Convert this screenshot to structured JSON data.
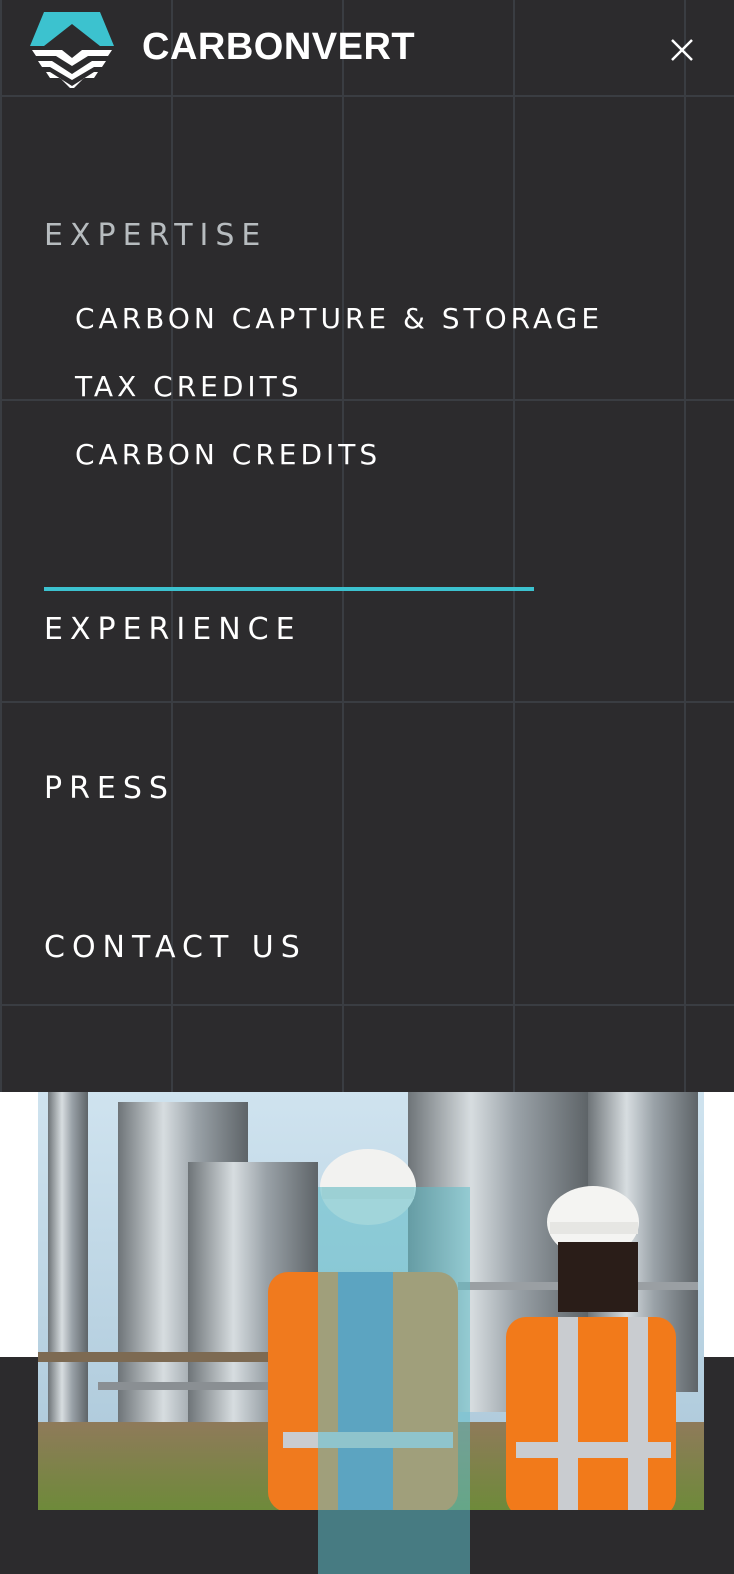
{
  "brand": {
    "name": "CARBONVERT"
  },
  "menu": {
    "close_label": "close-icon",
    "expertise": {
      "label": "EXPERTISE",
      "items": [
        {
          "label": "CARBON CAPTURE & STORAGE"
        },
        {
          "label": "TAX CREDITS"
        },
        {
          "label": "CARBON CREDITS"
        }
      ]
    },
    "experience": {
      "label": "EXPERIENCE"
    },
    "press": {
      "label": "PRESS"
    },
    "contact": {
      "label": "CONTACT US"
    }
  },
  "colors": {
    "background": "#2c2b2d",
    "accent": "#3cc2cf",
    "text": "#ffffff",
    "muted": "#b7bcbf"
  },
  "hero_image": {
    "icon": "industrial-workers-photo"
  }
}
